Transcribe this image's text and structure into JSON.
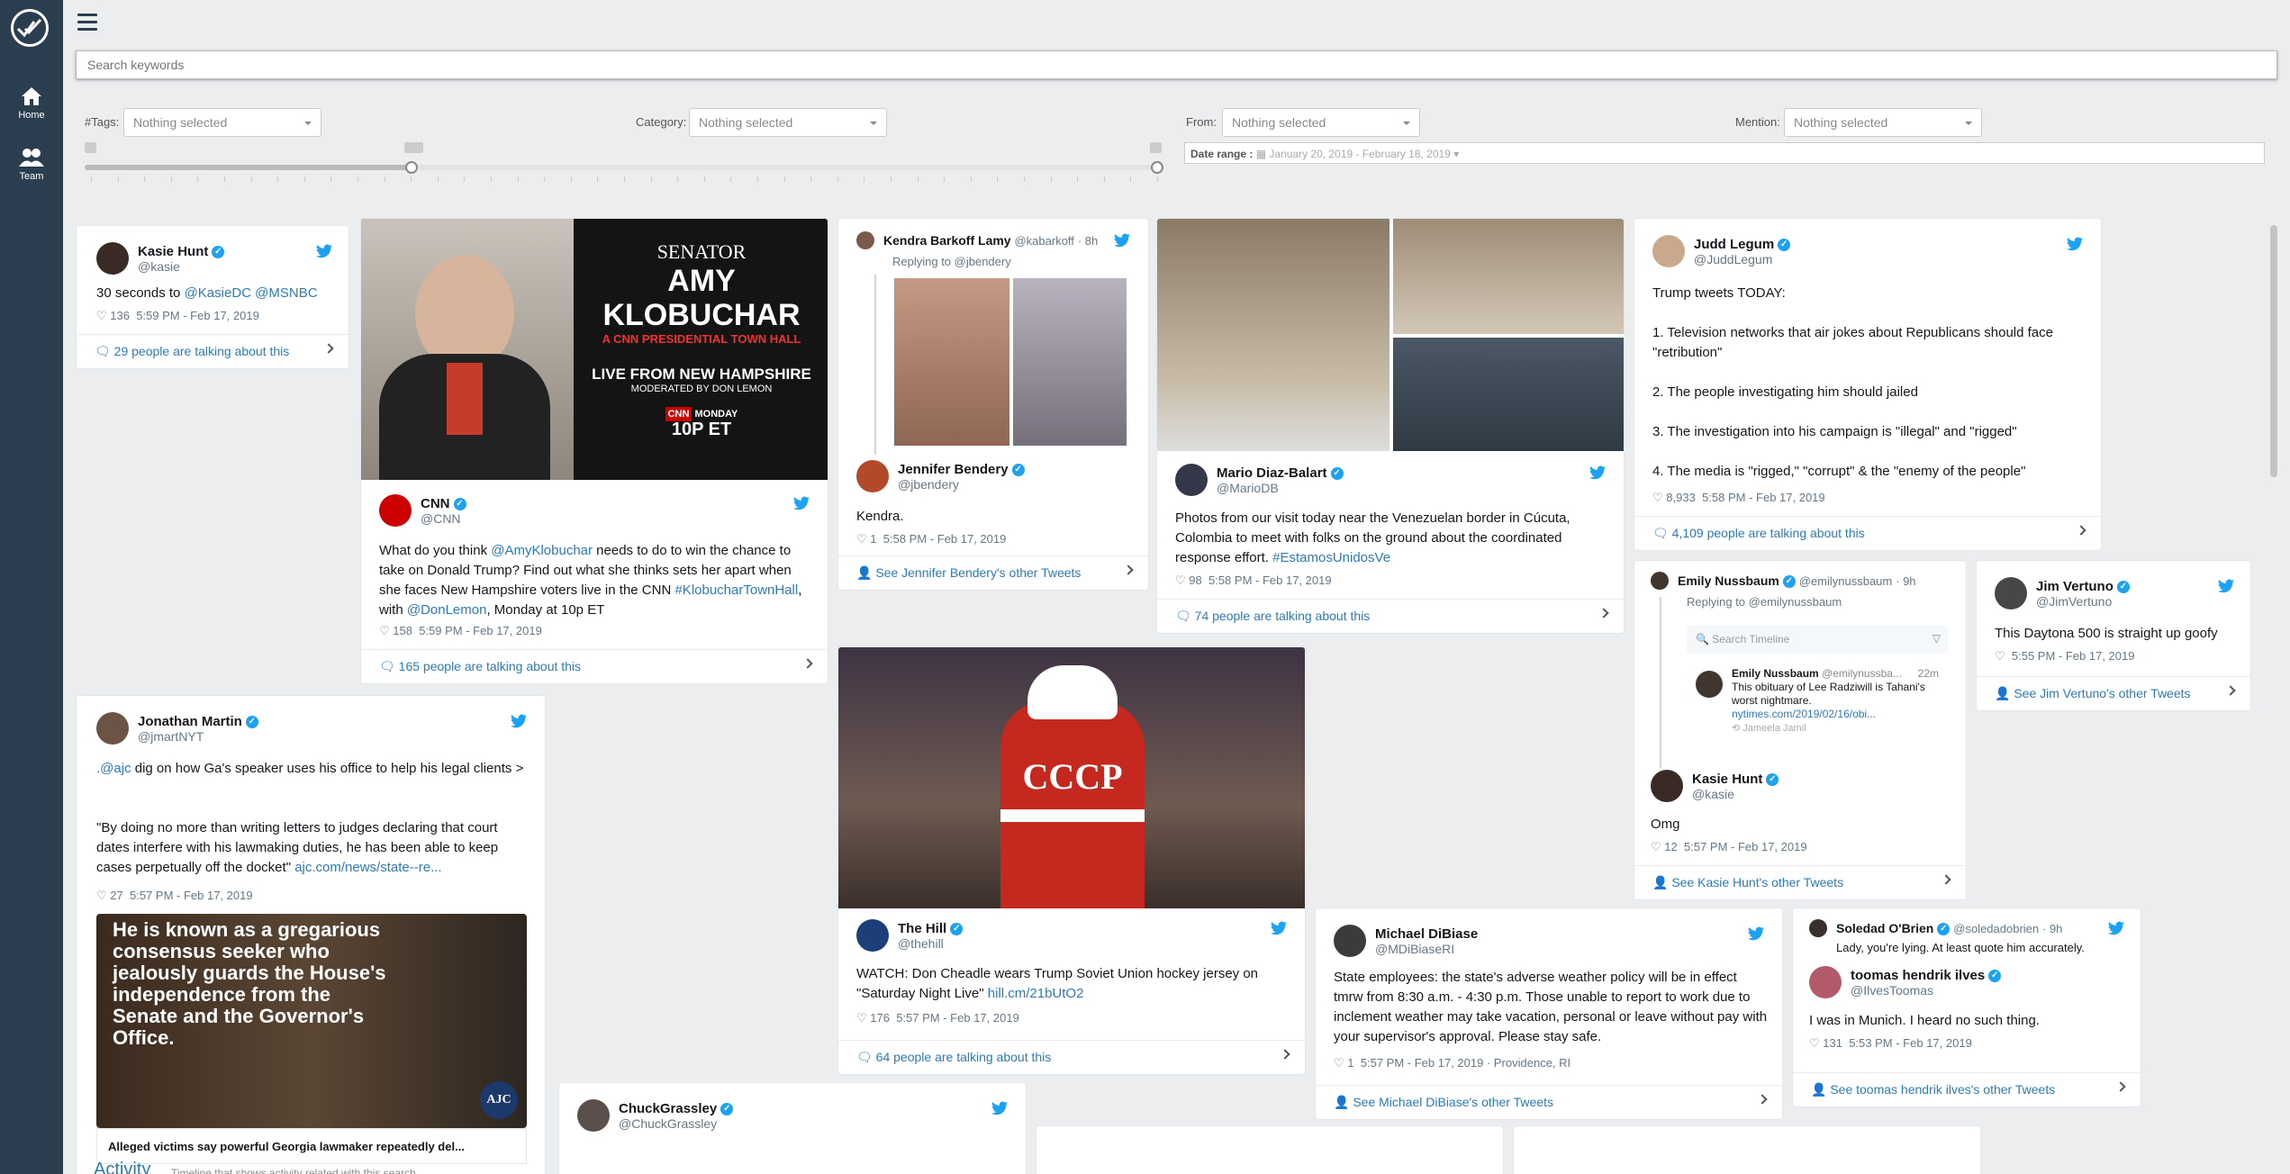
{
  "sidebar": {
    "home_label": "Home",
    "team_label": "Team"
  },
  "search": {
    "placeholder": "Search keywords"
  },
  "filters": {
    "tags_label": "#Tags:",
    "tags_value": "Nothing selected",
    "category_label": "Category:",
    "category_value": "Nothing selected",
    "from_label": "From:",
    "from_value": "Nothing selected",
    "mention_label": "Mention:",
    "mention_value": "Nothing selected",
    "date_range_label": "Date range :",
    "date_range_value": "January 20, 2019 - February 18, 2019",
    "slider_fraction": 0.3
  },
  "tweets": {
    "kasie": {
      "name": "Kasie Hunt",
      "handle": "@kasie",
      "text": "30 seconds to ",
      "m1": "@KasieDC",
      "m2": "@MSNBC",
      "likes": "136",
      "time": "5:59 PM - Feb 17, 2019",
      "footer": "29 people are talking about this"
    },
    "cnn": {
      "name": "CNN",
      "handle": "@CNN",
      "t1": "What do you think ",
      "m1": "@AmyKlobuchar",
      "t2": " needs to do to win the chance to take on Donald Trump? Find out what she thinks sets her apart when she faces New Hampshire voters live in the CNN ",
      "h1": "#KlobucharTownHall",
      "t3": ", with ",
      "m2": "@DonLemon",
      "t4": ", Monday at 10p ET",
      "likes": "158",
      "time": "5:59 PM - Feb 17, 2019",
      "footer": "165 people are talking about this",
      "img_senator": "SENATOR",
      "img_name": "AMY KLOBUCHAR",
      "img_sub": "A CNN PRESIDENTIAL TOWN HALL",
      "img_live": "LIVE FROM NEW HAMPSHIRE",
      "img_mod": "MODERATED BY DON LEMON",
      "img_day": "MONDAY",
      "img_time": "10P ET",
      "img_cnn": "CNN"
    },
    "kendra": {
      "name": "Kendra Barkoff Lamy",
      "handle": "@kabarkoff",
      "age": "· 8h",
      "reply": "Replying to @jbendery"
    },
    "bendery": {
      "name": "Jennifer Bendery",
      "handle": "@jbendery",
      "text": "Kendra.",
      "likes": "1",
      "time": "5:58 PM - Feb 17, 2019",
      "footer": "See Jennifer Bendery's other Tweets"
    },
    "mario": {
      "name": "Mario Diaz-Balart",
      "handle": "@MarioDB",
      "text": "Photos from our visit today near the Venezuelan border in Cúcuta, Colombia to meet with folks on the ground about the coordinated response effort. ",
      "h1": "#EstamosUnidosVe",
      "likes": "98",
      "time": "5:58 PM - Feb 17, 2019",
      "footer": "74 people are talking about this"
    },
    "judd": {
      "name": "Judd Legum",
      "handle": "@JuddLegum",
      "l1": "Trump tweets TODAY:",
      "l2": "1. Television networks that air jokes about Republicans should face \"retribution\"",
      "l3": "2. The people investigating him should jailed",
      "l4": "3. The investigation into his campaign is \"illegal\" and \"rigged\"",
      "l5": "4. The media is \"rigged,\" \"corrupt\" & the \"enemy of the people\"",
      "likes": "8,933",
      "time": "5:58 PM - Feb 17, 2019",
      "footer": "4,109 people are talking about this"
    },
    "emily": {
      "name": "Emily Nussbaum",
      "handle": "@emilynussbaum",
      "age": "· 9h",
      "reply": "Replying to @emilynussbaum",
      "search_ph": "Search Timeline",
      "inner_name": "Emily Nussbaum",
      "inner_handle": "@emilynussba...",
      "inner_age": "22m",
      "inner_text": "This obituary of Lee Radziwill is Tahani's worst nightmare.",
      "inner_link": "nytimes.com/2019/02/16/obi...",
      "inner_rt": "Jameela Jamil"
    },
    "kasie2": {
      "name": "Kasie Hunt",
      "handle": "@kasie",
      "text": "Omg",
      "likes": "12",
      "time": "5:57 PM - Feb 17, 2019",
      "footer": "See Kasie Hunt's other Tweets"
    },
    "jim": {
      "name": "Jim Vertuno",
      "handle": "@JimVertuno",
      "text": "This Daytona 500 is straight up goofy",
      "time": "5:55 PM - Feb 17, 2019",
      "footer": "See Jim Vertuno's other Tweets"
    },
    "jonathan": {
      "name": "Jonathan Martin",
      "handle": "@jmartNYT",
      "m1": ".@ajc",
      "t1": " dig on how Ga's speaker uses his office to help his legal clients >",
      "t2": "\"By doing no more than writing letters to judges declaring that court dates interfere with his lawmaking duties, he has been able to keep cases perpetually off the docket\" ",
      "link": "ajc.com/news/state--re...",
      "likes": "27",
      "time": "5:57 PM - Feb 17, 2019",
      "img_text": "He is known as a gregarious consensus seeker who jealously guards the House's independence from the Senate and the Governor's Office.",
      "img_badge": "AJC",
      "caption": "Alleged victims say powerful Georgia lawmaker repeatedly del..."
    },
    "thehill": {
      "name": "The Hill",
      "handle": "@thehill",
      "t1": "WATCH: Don Cheadle wears Trump Soviet Union hockey jersey on \"Saturday Night Live\" ",
      "link": "hill.cm/21bUtO2",
      "likes": "176",
      "time": "5:57 PM - Feb 17, 2019",
      "footer": "64 people are talking about this",
      "jersey": "CCCP"
    },
    "dibiase": {
      "name": "Michael DiBiase",
      "handle": "@MDiBiaseRI",
      "text": "State employees: the state's adverse weather policy will be in effect tmrw from 8:30 a.m. - 4:30 p.m. Those unable to report to work due to inclement weather may take vacation, personal or leave without pay with your supervisor's approval. Please stay safe.",
      "likes": "1",
      "time": "5:57 PM - Feb 17, 2019 · Providence, RI",
      "footer": "See Michael DiBiase's other Tweets"
    },
    "soledad": {
      "name": "Soledad O'Brien",
      "handle": "@soledadobrien",
      "age": "· 9h",
      "quote": "Lady, you're lying. At least quote him accurately."
    },
    "toomas": {
      "name": "toomas hendrik ilves",
      "handle": "@IlvesToomas",
      "text": "I was in Munich. I heard no such thing.",
      "likes": "131",
      "time": "5:53 PM - Feb 17, 2019",
      "footer": "See toomas hendrik ilves's other Tweets"
    },
    "grassley": {
      "name": "ChuckGrassley",
      "handle": "@ChuckGrassley"
    }
  },
  "activity": {
    "title": "Activity",
    "sub": "Timeline that shows activity related with this search"
  },
  "colors": {
    "sidebar": "#2b3e50",
    "accent": "#1da1f2",
    "link": "#2b7bb9"
  }
}
